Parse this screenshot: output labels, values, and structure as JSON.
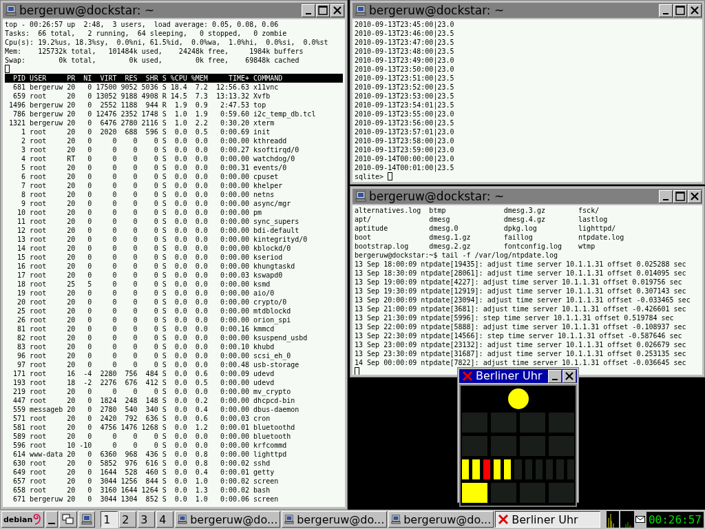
{
  "windows": [
    {
      "title": "bergeruw@dockstar: ~",
      "kind": "terminal",
      "active": false,
      "summary": [
        "top - 00:26:57 up  2:48,  3 users,  load average: 0.05, 0.08, 0.06",
        "Tasks:  66 total,   2 running,  64 sleeping,   0 stopped,   0 zombie",
        "Cpu(s): 19.2%us, 18.3%sy,  0.0%ni, 61.5%id,  0.0%wa,  1.0%hi,  0.0%si,  0.0%st",
        "Mem:    125732k total,   101484k used,    24248k free,     1984k buffers",
        "Swap:        0k total,        0k used,        0k free,    69848k cached"
      ],
      "columns": [
        "PID",
        "USER",
        "PR",
        "NI",
        "VIRT",
        "RES",
        "SHR",
        "S",
        "%CPU",
        "%MEM",
        "TIME+",
        "COMMAND"
      ],
      "rows": [
        [
          "681",
          "bergeruw",
          "20",
          "0",
          "17500",
          "9052",
          "5036",
          "S",
          "18.4",
          "7.2",
          "12:56.63",
          "x11vnc"
        ],
        [
          "659",
          "root",
          "20",
          "0",
          "13052",
          "9188",
          "4908",
          "R",
          "14.5",
          "7.3",
          "13:13.32",
          "Xvfb"
        ],
        [
          "1496",
          "bergeruw",
          "20",
          "0",
          "2552",
          "1188",
          "944",
          "R",
          "1.9",
          "0.9",
          "2:47.53",
          "top"
        ],
        [
          "786",
          "bergeruw",
          "20",
          "0",
          "12476",
          "2352",
          "1748",
          "S",
          "1.0",
          "1.9",
          "0:59.60",
          "i2c_temp_db.tcl"
        ],
        [
          "1321",
          "bergeruw",
          "20",
          "0",
          "6476",
          "2780",
          "2116",
          "S",
          "1.0",
          "2.2",
          "0:30.20",
          "xterm"
        ],
        [
          "1",
          "root",
          "20",
          "0",
          "2020",
          "688",
          "596",
          "S",
          "0.0",
          "0.5",
          "0:00.69",
          "init"
        ],
        [
          "2",
          "root",
          "20",
          "0",
          "0",
          "0",
          "0",
          "S",
          "0.0",
          "0.0",
          "0:00.00",
          "kthreadd"
        ],
        [
          "3",
          "root",
          "20",
          "0",
          "0",
          "0",
          "0",
          "S",
          "0.0",
          "0.0",
          "0:00.27",
          "ksoftirqd/0"
        ],
        [
          "4",
          "root",
          "RT",
          "0",
          "0",
          "0",
          "0",
          "S",
          "0.0",
          "0.0",
          "0:00.00",
          "watchdog/0"
        ],
        [
          "5",
          "root",
          "20",
          "0",
          "0",
          "0",
          "0",
          "S",
          "0.0",
          "0.0",
          "0:00.31",
          "events/0"
        ],
        [
          "6",
          "root",
          "20",
          "0",
          "0",
          "0",
          "0",
          "S",
          "0.0",
          "0.0",
          "0:00.00",
          "cpuset"
        ],
        [
          "7",
          "root",
          "20",
          "0",
          "0",
          "0",
          "0",
          "S",
          "0.0",
          "0.0",
          "0:00.00",
          "khelper"
        ],
        [
          "8",
          "root",
          "20",
          "0",
          "0",
          "0",
          "0",
          "S",
          "0.0",
          "0.0",
          "0:00.00",
          "netns"
        ],
        [
          "9",
          "root",
          "20",
          "0",
          "0",
          "0",
          "0",
          "S",
          "0.0",
          "0.0",
          "0:00.00",
          "async/mgr"
        ],
        [
          "10",
          "root",
          "20",
          "0",
          "0",
          "0",
          "0",
          "S",
          "0.0",
          "0.0",
          "0:00.00",
          "pm"
        ],
        [
          "11",
          "root",
          "20",
          "0",
          "0",
          "0",
          "0",
          "S",
          "0.0",
          "0.0",
          "0:00.00",
          "sync_supers"
        ],
        [
          "12",
          "root",
          "20",
          "0",
          "0",
          "0",
          "0",
          "S",
          "0.0",
          "0.0",
          "0:00.00",
          "bdi-default"
        ],
        [
          "13",
          "root",
          "20",
          "0",
          "0",
          "0",
          "0",
          "S",
          "0.0",
          "0.0",
          "0:00.00",
          "kintegrityd/0"
        ],
        [
          "14",
          "root",
          "20",
          "0",
          "0",
          "0",
          "0",
          "S",
          "0.0",
          "0.0",
          "0:00.00",
          "kblockd/0"
        ],
        [
          "15",
          "root",
          "20",
          "0",
          "0",
          "0",
          "0",
          "S",
          "0.0",
          "0.0",
          "0:00.00",
          "kseriod"
        ],
        [
          "16",
          "root",
          "20",
          "0",
          "0",
          "0",
          "0",
          "S",
          "0.0",
          "0.0",
          "0:00.00",
          "khungtaskd"
        ],
        [
          "17",
          "root",
          "20",
          "0",
          "0",
          "0",
          "0",
          "S",
          "0.0",
          "0.0",
          "0:00.03",
          "kswapd0"
        ],
        [
          "18",
          "root",
          "25",
          "5",
          "0",
          "0",
          "0",
          "S",
          "0.0",
          "0.0",
          "0:00.00",
          "ksmd"
        ],
        [
          "19",
          "root",
          "20",
          "0",
          "0",
          "0",
          "0",
          "S",
          "0.0",
          "0.0",
          "0:00.00",
          "aio/0"
        ],
        [
          "20",
          "root",
          "20",
          "0",
          "0",
          "0",
          "0",
          "S",
          "0.0",
          "0.0",
          "0:00.00",
          "crypto/0"
        ],
        [
          "25",
          "root",
          "20",
          "0",
          "0",
          "0",
          "0",
          "S",
          "0.0",
          "0.0",
          "0:00.00",
          "mtdblockd"
        ],
        [
          "26",
          "root",
          "20",
          "0",
          "0",
          "0",
          "0",
          "S",
          "0.0",
          "0.0",
          "0:00.00",
          "orion_spi"
        ],
        [
          "81",
          "root",
          "20",
          "0",
          "0",
          "0",
          "0",
          "S",
          "0.0",
          "0.0",
          "0:00.16",
          "kmmcd"
        ],
        [
          "82",
          "root",
          "20",
          "0",
          "0",
          "0",
          "0",
          "S",
          "0.0",
          "0.0",
          "0:00.00",
          "ksuspend_usbd"
        ],
        [
          "83",
          "root",
          "20",
          "0",
          "0",
          "0",
          "0",
          "S",
          "0.0",
          "0.0",
          "0:00.10",
          "khubd"
        ],
        [
          "96",
          "root",
          "20",
          "0",
          "0",
          "0",
          "0",
          "S",
          "0.0",
          "0.0",
          "0:00.00",
          "scsi_eh_0"
        ],
        [
          "97",
          "root",
          "20",
          "0",
          "0",
          "0",
          "0",
          "S",
          "0.0",
          "0.0",
          "0:00.48",
          "usb-storage"
        ],
        [
          "171",
          "root",
          "16",
          "-4",
          "2280",
          "756",
          "484",
          "S",
          "0.0",
          "0.6",
          "0:00.09",
          "udevd"
        ],
        [
          "193",
          "root",
          "18",
          "-2",
          "2276",
          "676",
          "412",
          "S",
          "0.0",
          "0.5",
          "0:00.00",
          "udevd"
        ],
        [
          "219",
          "root",
          "20",
          "0",
          "0",
          "0",
          "0",
          "S",
          "0.0",
          "0.0",
          "0:00.00",
          "mv_crypto"
        ],
        [
          "447",
          "root",
          "20",
          "0",
          "1824",
          "248",
          "148",
          "S",
          "0.0",
          "0.2",
          "0:00.00",
          "dhcpcd-bin"
        ],
        [
          "559",
          "messageb",
          "20",
          "0",
          "2780",
          "540",
          "340",
          "S",
          "0.0",
          "0.4",
          "0:00.00",
          "dbus-daemon"
        ],
        [
          "571",
          "root",
          "20",
          "0",
          "2420",
          "792",
          "636",
          "S",
          "0.0",
          "0.6",
          "0:00.03",
          "cron"
        ],
        [
          "581",
          "root",
          "20",
          "0",
          "4756",
          "1476",
          "1268",
          "S",
          "0.0",
          "1.2",
          "0:00.01",
          "bluetoothd"
        ],
        [
          "589",
          "root",
          "20",
          "0",
          "0",
          "0",
          "0",
          "S",
          "0.0",
          "0.0",
          "0:00.00",
          "bluetooth"
        ],
        [
          "596",
          "root",
          "10",
          "-10",
          "0",
          "0",
          "0",
          "S",
          "0.0",
          "0.0",
          "0:00.00",
          "krfcommd"
        ],
        [
          "614",
          "www-data",
          "20",
          "0",
          "6360",
          "968",
          "436",
          "S",
          "0.0",
          "0.8",
          "0:00.00",
          "lighttpd"
        ],
        [
          "630",
          "root",
          "20",
          "0",
          "5852",
          "976",
          "616",
          "S",
          "0.0",
          "0.8",
          "0:00.02",
          "sshd"
        ],
        [
          "649",
          "root",
          "20",
          "0",
          "1644",
          "528",
          "460",
          "S",
          "0.0",
          "0.4",
          "0:00.01",
          "getty"
        ],
        [
          "657",
          "root",
          "20",
          "0",
          "3044",
          "1256",
          "844",
          "S",
          "0.0",
          "1.0",
          "0:00.02",
          "screen"
        ],
        [
          "658",
          "root",
          "20",
          "0",
          "3160",
          "1644",
          "1264",
          "S",
          "0.0",
          "1.3",
          "0:00.02",
          "bash"
        ],
        [
          "671",
          "bergeruw",
          "20",
          "0",
          "3044",
          "1304",
          "852",
          "S",
          "0.0",
          "1.0",
          "0:00.06",
          "screen"
        ]
      ]
    },
    {
      "title": "bergeruw@dockstar: ~",
      "kind": "terminal",
      "active": false,
      "lines": [
        "2010-09-13T23:45:00|23.0",
        "2010-09-13T23:46:00|23.5",
        "2010-09-13T23:47:00|23.5",
        "2010-09-13T23:48:00|23.5",
        "2010-09-13T23:49:00|23.0",
        "2010-09-13T23:50:00|23.0",
        "2010-09-13T23:51:00|23.5",
        "2010-09-13T23:52:00|23.5",
        "2010-09-13T23:53:00|23.5",
        "2010-09-13T23:54:01|23.5",
        "2010-09-13T23:55:00|23.0",
        "2010-09-13T23:56:00|23.5",
        "2010-09-13T23:57:01|23.0",
        "2010-09-13T23:58:00|23.0",
        "2010-09-13T23:59:00|23.0",
        "2010-09-14T00:00:00|23.0",
        "2010-09-14T00:01:00|23.5"
      ],
      "prompt": "sqlite>"
    },
    {
      "title": "bergeruw@dockstar: ~",
      "kind": "terminal",
      "active": false,
      "listing": [
        [
          "alternatives.log",
          "btmp",
          "dmesg.3.gz",
          "fsck/"
        ],
        [
          "apt/",
          "dmesg",
          "dmesg.4.gz",
          "lastlog"
        ],
        [
          "aptitude",
          "dmesg.0",
          "dpkg.log",
          "lighttpd/"
        ],
        [
          "boot",
          "dmesg.1.gz",
          "faillog",
          "ntpdate.log"
        ],
        [
          "bootstrap.log",
          "dmesg.2.gz",
          "fontconfig.log",
          "wtmp"
        ]
      ],
      "lines": [
        "bergeruw@dockstar:~$ tail -f /var/log/ntpdate.log",
        "13 Sep 18:00:09 ntpdate[19435]: adjust time server 10.1.1.31 offset 0.025288 sec",
        "13 Sep 18:30:09 ntpdate[28061]: adjust time server 10.1.1.31 offset 0.014095 sec",
        "13 Sep 19:00:09 ntpdate[4227]: adjust time server 10.1.1.31 offset 0.019756 sec",
        "13 Sep 19:30:09 ntpdate[12919]: adjust time server 10.1.1.31 offset 0.307143 sec",
        "13 Sep 20:00:09 ntpdate[23094]: adjust time server 10.1.1.31 offset -0.033465 sec",
        "13 Sep 21:00:09 ntpdate[3681]: adjust time server 10.1.1.31 offset -0.426601 sec",
        "13 Sep 21:30:09 ntpdate[5996]: step time server 10.1.1.31 offset 0.519784 sec",
        "13 Sep 22:00:09 ntpdate[5888]: adjust time server 10.1.1.31 offset -0.108937 sec",
        "13 Sep 22:30:09 ntpdate[14566]: step time server 10.1.1.31 offset -0.587646 sec",
        "13 Sep 23:00:09 ntpdate[23132]: adjust time server 10.1.1.31 offset 0.026679 sec",
        "13 Sep 23:30:09 ntpdate[31687]: adjust time server 10.1.1.31 offset 0.253135 sec",
        "14 Sep 00:00:09 ntpdate[7822]: adjust time server 10.1.1.31 offset -0.036645 sec"
      ]
    }
  ],
  "clock_window": {
    "title": "Berliner Uhr",
    "kind": "x-app",
    "active": true,
    "seconds_lamp": {
      "on": true,
      "color": "#ffff00"
    },
    "lamp_rows": [
      [
        {
          "on": false
        },
        {
          "on": false
        },
        {
          "on": false
        },
        {
          "on": false
        }
      ],
      [
        {
          "on": false
        },
        {
          "on": false
        },
        {
          "on": false
        },
        {
          "on": false
        }
      ],
      [
        {
          "on": true,
          "color": "#ffff00"
        },
        {
          "on": true,
          "color": "#ffff00"
        },
        {
          "on": true,
          "color": "#ff0000"
        },
        {
          "on": true,
          "color": "#ffff00"
        },
        {
          "on": true,
          "color": "#ffff00"
        },
        {
          "on": false
        },
        {
          "on": false
        },
        {
          "on": false
        },
        {
          "on": false
        },
        {
          "on": false
        },
        {
          "on": false
        }
      ],
      [
        {
          "on": true,
          "color": "#ffff00"
        },
        {
          "on": false
        },
        {
          "on": false
        },
        {
          "on": false
        }
      ]
    ]
  },
  "taskbar": {
    "logo": "debian",
    "desktops": [
      {
        "label": "1",
        "selected": true
      },
      {
        "label": "2",
        "selected": false
      },
      {
        "label": "3",
        "selected": false
      },
      {
        "label": "4",
        "selected": false
      }
    ],
    "tasks": [
      {
        "title": "bergeruw@do...",
        "kind": "terminal",
        "selected": false
      },
      {
        "title": "bergeruw@do...",
        "kind": "terminal",
        "selected": false
      },
      {
        "title": "bergeruw@do...",
        "kind": "terminal",
        "selected": false
      },
      {
        "title": "Berliner Uhr",
        "kind": "x-app",
        "selected": true
      }
    ],
    "clock": "00:26:57"
  }
}
